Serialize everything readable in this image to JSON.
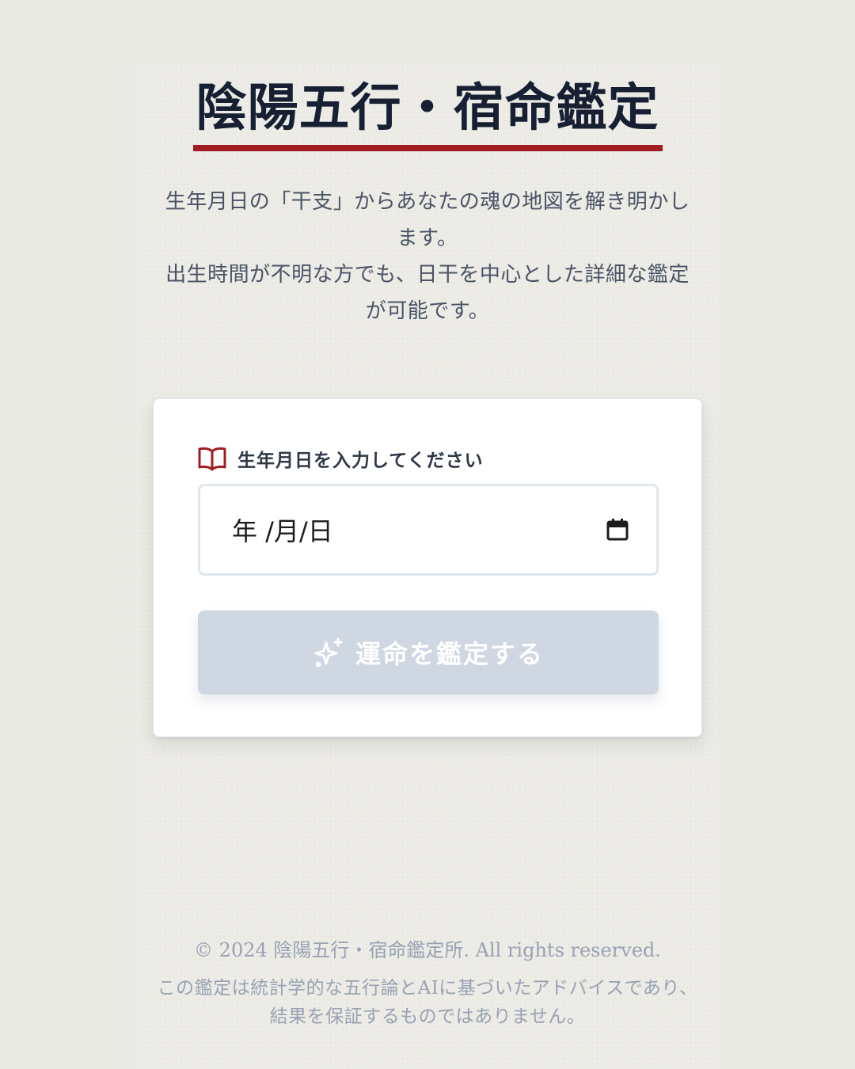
{
  "header": {
    "title": "陰陽五行・宿命鑑定"
  },
  "intro": {
    "line1": "生年月日の「干支」からあなたの魂の地図を解き明かします。",
    "line2": "出生時間が不明な方でも、日干を中心とした詳細な鑑定が可能です。"
  },
  "form": {
    "label": "生年月日を入力してください",
    "label_icon": "book-open-icon",
    "date_display": "年 /月/日",
    "date_icon": "calendar-icon",
    "submit_label": "運命を鑑定する",
    "submit_icon": "sparkles-icon",
    "submit_disabled": true
  },
  "footer": {
    "copyright": "© 2024 陰陽五行・宿命鑑定所. All rights reserved.",
    "disclaimer": "この鑑定は統計学的な五行論とAIに基づいたアドバイスであり、結果を保証するものではありません。"
  },
  "colors": {
    "background": "#e9eae3",
    "title": "#172033",
    "accent_red": "#a01c22",
    "button_disabled": "#cfd7e3",
    "footer_text": "#98a2b4"
  }
}
